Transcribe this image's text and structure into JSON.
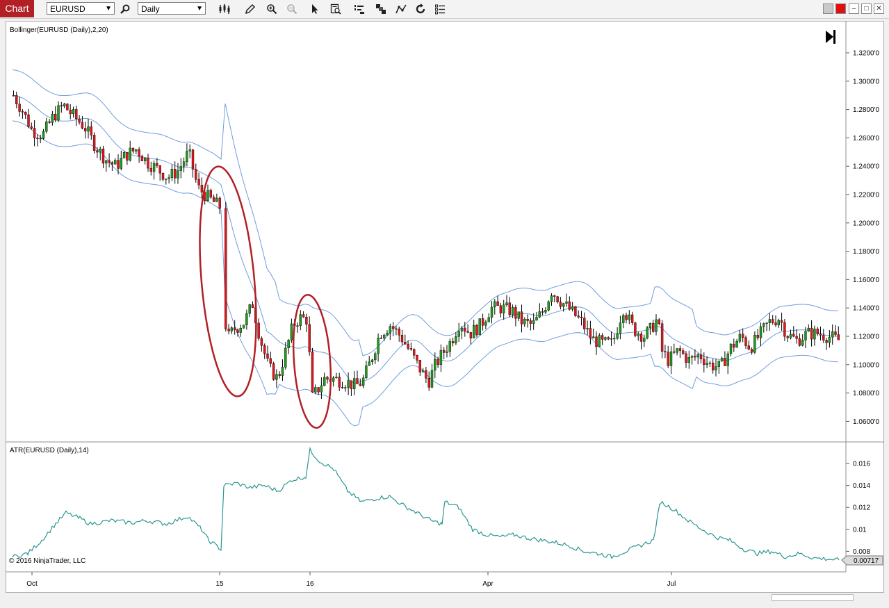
{
  "toolbar": {
    "chart_tab": "Chart",
    "instrument": "EURUSD",
    "interval": "Daily"
  },
  "price_pane": {
    "indicator_label": "Bollinger(EURUSD (Daily),2,20)",
    "y_ticks": [
      "1.3200'0",
      "1.3000'0",
      "1.2800'0",
      "1.2600'0",
      "1.2400'0",
      "1.2200'0",
      "1.2000'0",
      "1.1800'0",
      "1.1600'0",
      "1.1400'0",
      "1.1200'0",
      "1.1000'0",
      "1.0800'0",
      "1.0600'0"
    ]
  },
  "atr_pane": {
    "indicator_label": "ATR(EURUSD (Daily),14)",
    "y_ticks": [
      "0.016",
      "0.014",
      "0.012",
      "0.01",
      "0.008"
    ],
    "current_value": "0.00717"
  },
  "x_axis": {
    "labels": [
      "Oct",
      "15",
      "16",
      "Apr",
      "Jul"
    ]
  },
  "copyright": "© 2016 NinjaTrader, LLC",
  "colors": {
    "up": "#1f9b1f",
    "down": "#e0161b",
    "band": "#6f9ddc",
    "atr": "#2a9690",
    "annotation": "#b21f24",
    "tab": "#b21f24"
  }
}
